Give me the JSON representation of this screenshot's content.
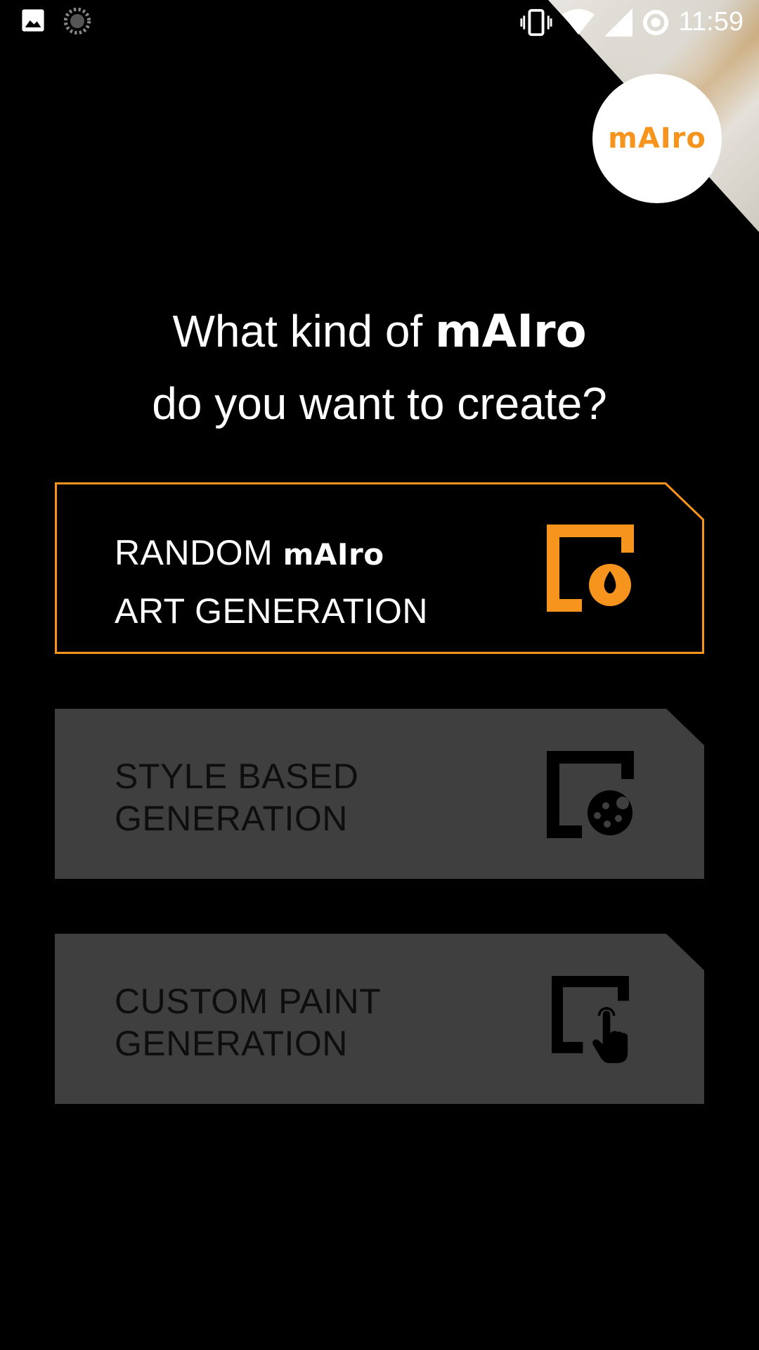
{
  "status_bar": {
    "time": "11:59",
    "icons": [
      "gallery-icon",
      "loading-icon",
      "vibrate-icon",
      "wifi-icon",
      "signal-icon",
      "sync-icon"
    ]
  },
  "logo": {
    "text": "mAIro",
    "color": "#f7941d"
  },
  "heading": {
    "line1_prefix": "What kind of ",
    "brand": "mAIro",
    "line2": "do you want to create?"
  },
  "options": [
    {
      "line1_prefix": "RANDOM ",
      "brand": "mAIro",
      "line2": "ART GENERATION",
      "icon": "drop-frame-icon",
      "selected": true
    },
    {
      "line1": "STYLE BASED",
      "line2": "GENERATION",
      "icon": "palette-frame-icon",
      "selected": false
    },
    {
      "line1": "CUSTOM PAINT",
      "line2": "GENERATION",
      "icon": "touch-frame-icon",
      "selected": false
    }
  ],
  "colors": {
    "accent": "#f7941d",
    "card_inactive": "#3f3f3f",
    "background": "#000000"
  }
}
